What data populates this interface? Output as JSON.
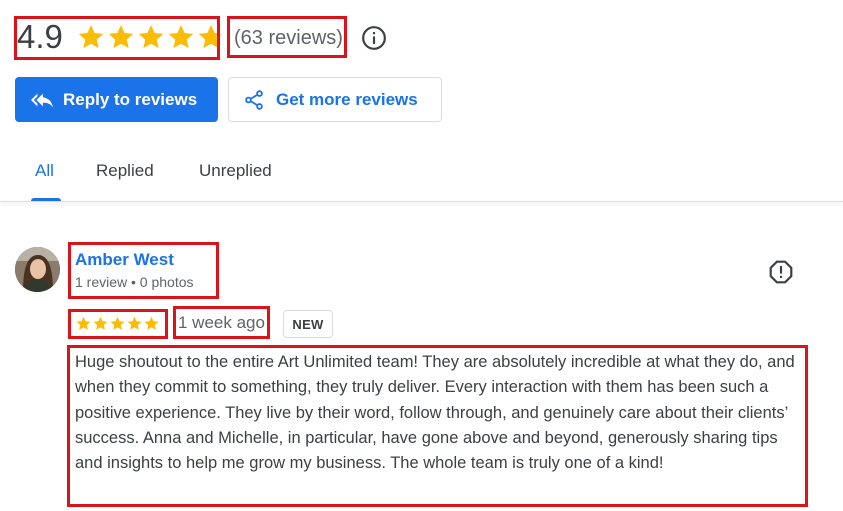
{
  "summary": {
    "rating": "4.9",
    "rating_stars": 4.9,
    "reviews_count": "(63 reviews)"
  },
  "actions": {
    "reply_label": "Reply to reviews",
    "get_more_label": "Get more reviews"
  },
  "tabs": [
    {
      "label": "All",
      "active": true
    },
    {
      "label": "Replied",
      "active": false
    },
    {
      "label": "Unreplied",
      "active": false
    }
  ],
  "review": {
    "name": "Amber West",
    "meta": "1 review • 0 photos",
    "stars": 5,
    "date": "1 week ago",
    "badge": "NEW",
    "text": "Huge shoutout to the entire Art Unlimited team! They are absolutely incredible at what they do, and when they commit to something, they truly deliver. Every interaction with them has been such a positive experience. They live by their word, follow through, and genuinely care about their clients’ success. Anna and Michelle, in particular, have gone above and beyond, generously sharing tips and insights to help me grow my business. The whole team is truly one of a kind!"
  },
  "colors": {
    "accent": "#1a73e8",
    "star": "#fbbc04",
    "highlight": "#d9151b"
  },
  "icons": {
    "info": "info-icon",
    "reply": "reply-all-icon",
    "share": "share-icon",
    "flag": "report-icon",
    "star": "star-icon"
  }
}
